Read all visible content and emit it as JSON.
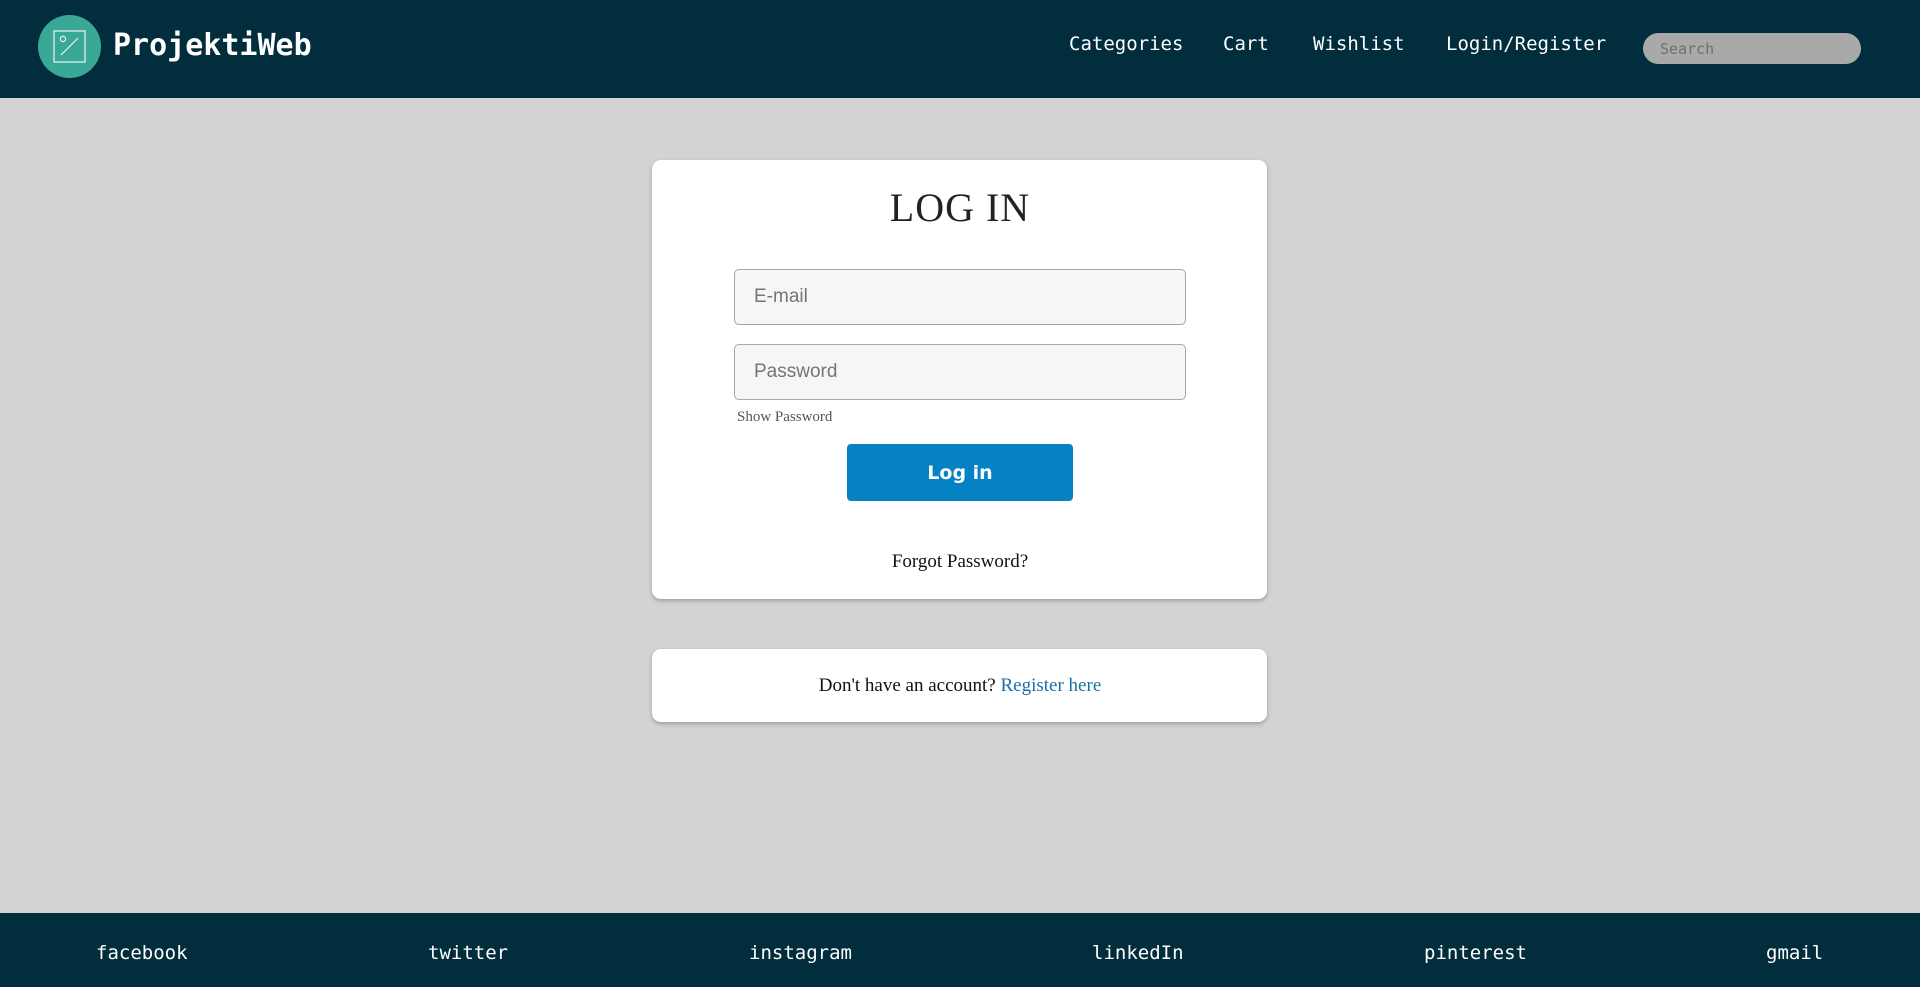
{
  "header": {
    "brand": "ProjektiWeb",
    "logo_icon": "image-placeholder-icon",
    "nav": {
      "categories": "Categories",
      "cart": "Cart",
      "wishlist": "Wishlist",
      "login_register": "Login/Register"
    },
    "search_placeholder": "Search"
  },
  "login": {
    "title": "LOG IN",
    "email_placeholder": "E-mail",
    "password_placeholder": "Password",
    "show_password": "Show Password",
    "button_label": "Log in",
    "forgot_password": "Forgot Password?"
  },
  "register": {
    "prompt": "Don't have an account?",
    "link": "Register here"
  },
  "footer": {
    "facebook": "facebook",
    "twitter": "twitter",
    "instagram": "instagram",
    "linkedin": "linkedIn",
    "pinterest": "pinterest",
    "gmail": "gmail"
  },
  "colors": {
    "header_bg": "#022d3d",
    "page_bg": "#d3d3d3",
    "logo_circle": "#3aa896",
    "button": "#0582c4",
    "link": "#1a6fa8"
  }
}
